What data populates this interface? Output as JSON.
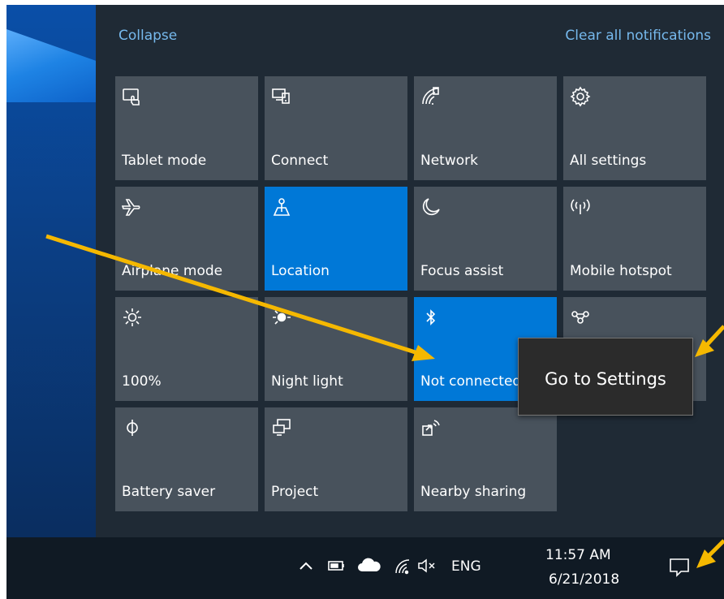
{
  "action_center": {
    "collapse_label": "Collapse",
    "clear_label": "Clear all notifications",
    "tiles": [
      {
        "label": "Tablet mode",
        "icon": "tablet-mode-icon",
        "active": false
      },
      {
        "label": "Connect",
        "icon": "connect-icon",
        "active": false
      },
      {
        "label": "Network",
        "icon": "network-icon",
        "active": false
      },
      {
        "label": "All settings",
        "icon": "gear-icon",
        "active": false
      },
      {
        "label": "Airplane mode",
        "icon": "airplane-icon",
        "active": false
      },
      {
        "label": "Location",
        "icon": "location-icon",
        "active": true
      },
      {
        "label": "Focus assist",
        "icon": "moon-icon",
        "active": false
      },
      {
        "label": "Mobile hotspot",
        "icon": "hotspot-icon",
        "active": false
      },
      {
        "label": "100%",
        "icon": "brightness-icon",
        "active": false
      },
      {
        "label": "Night light",
        "icon": "night-light-icon",
        "active": false
      },
      {
        "label": "Not connected",
        "icon": "bluetooth-icon",
        "active": true
      },
      {
        "label": "",
        "icon": "vpn-icon",
        "active": false
      },
      {
        "label": "Battery saver",
        "icon": "battery-saver-icon",
        "active": false
      },
      {
        "label": "Project",
        "icon": "project-icon",
        "active": false
      },
      {
        "label": "Nearby sharing",
        "icon": "nearby-sharing-icon",
        "active": false
      }
    ]
  },
  "tooltip": {
    "label": "Go to Settings"
  },
  "taskbar": {
    "tray_icons": [
      "chevron-up-icon",
      "battery-icon",
      "onedrive-icon",
      "wifi-icon",
      "volume-mute-icon"
    ],
    "language": "ENG",
    "time": "11:57 AM",
    "date": "6/21/2018",
    "notification_icon": "action-center-icon"
  },
  "colors": {
    "accent": "#0078d7",
    "tile": "#48525c",
    "panel": "#1f2a35",
    "annotation_arrow": "#f5b800",
    "link": "#76b9ed"
  }
}
